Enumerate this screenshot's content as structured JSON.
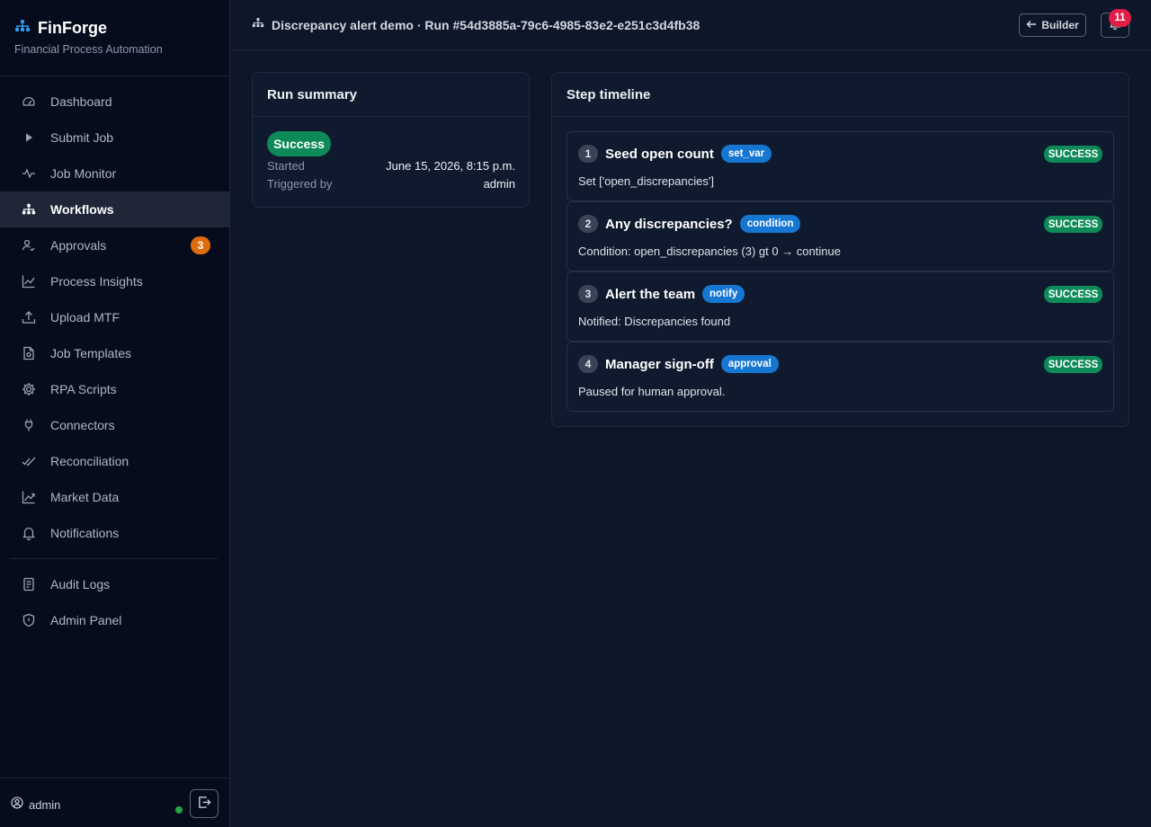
{
  "brand": {
    "name": "FinForge",
    "subtitle": "Financial Process Automation"
  },
  "nav": {
    "items": [
      {
        "label": "Dashboard"
      },
      {
        "label": "Submit Job"
      },
      {
        "label": "Job Monitor"
      },
      {
        "label": "Workflows",
        "active": true
      },
      {
        "label": "Approvals",
        "badge": "3"
      },
      {
        "label": "Process Insights"
      },
      {
        "label": "Upload MTF"
      },
      {
        "label": "Job Templates"
      },
      {
        "label": "RPA Scripts"
      },
      {
        "label": "Connectors"
      },
      {
        "label": "Reconciliation"
      },
      {
        "label": "Market Data"
      },
      {
        "label": "Notifications"
      }
    ],
    "secondary": [
      {
        "label": "Audit Logs"
      },
      {
        "label": "Admin Panel"
      }
    ]
  },
  "footer": {
    "username": "admin"
  },
  "topbar": {
    "title": "Discrepancy alert demo · Run #54d3885a-79c6-4985-83e2-e251c3d4fb38",
    "builder_label": "Builder",
    "notification_count": "11"
  },
  "summary": {
    "title": "Run summary",
    "status": "Success",
    "started_label": "Started",
    "started_value": "June 15, 2026, 8:15 p.m.",
    "triggered_label": "Triggered by",
    "triggered_value": "admin"
  },
  "timeline": {
    "title": "Step timeline",
    "steps": [
      {
        "num": "1",
        "title": "Seed open count",
        "type": "set_var",
        "status": "SUCCESS",
        "detail": "Set ['open_discrepancies']"
      },
      {
        "num": "2",
        "title": "Any discrepancies?",
        "type": "condition",
        "status": "SUCCESS",
        "detail": "Condition: open_discrepancies (3) gt 0 → continue"
      },
      {
        "num": "3",
        "title": "Alert the team",
        "type": "notify",
        "status": "SUCCESS",
        "detail": "Notified: Discrepancies found"
      },
      {
        "num": "4",
        "title": "Manager sign-off",
        "type": "approval",
        "status": "SUCCESS",
        "detail": "Paused for human approval."
      }
    ]
  },
  "colors": {
    "accent": "#1677d2",
    "success": "#0d8a58",
    "warning_badge": "#e06c0d",
    "alert_badge": "#e11d48",
    "online": "#22a447"
  },
  "icons": {
    "brand": "sitemap-icon",
    "nav": [
      "gauge-icon",
      "play-icon",
      "activity-icon",
      "sitemap-icon",
      "person-check-icon",
      "chart-line-icon",
      "upload-icon",
      "file-template-icon",
      "gear-icon",
      "plug-icon",
      "check-double-icon",
      "graph-up-icon",
      "bell-icon",
      "journal-icon",
      "shield-icon"
    ]
  }
}
